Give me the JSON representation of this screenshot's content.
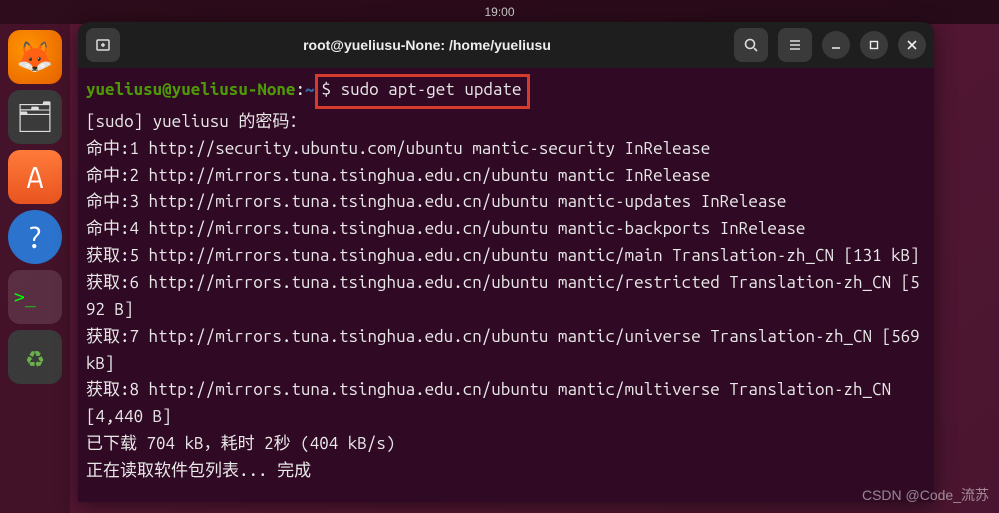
{
  "top_panel": {
    "clock": "19:00"
  },
  "dock": {
    "items": [
      {
        "name": "firefox",
        "glyph": "🦊"
      },
      {
        "name": "files",
        "glyph": "🗂"
      },
      {
        "name": "software",
        "glyph": "A"
      },
      {
        "name": "help",
        "glyph": "?"
      },
      {
        "name": "terminal",
        "glyph": ">_"
      },
      {
        "name": "trash",
        "glyph": "♻"
      }
    ]
  },
  "window": {
    "title": "root@yueliusu-None: /home/yueliusu"
  },
  "terminal": {
    "prompt": {
      "user_host": "yueliusu@yueliusu-None",
      "sep1": ":",
      "path": "~",
      "symbol": "$",
      "command": "sudo apt-get update"
    },
    "lines": [
      "[sudo] yueliusu 的密码：",
      "命中:1 http://security.ubuntu.com/ubuntu mantic-security InRelease",
      "命中:2 http://mirrors.tuna.tsinghua.edu.cn/ubuntu mantic InRelease",
      "命中:3 http://mirrors.tuna.tsinghua.edu.cn/ubuntu mantic-updates InRelease",
      "命中:4 http://mirrors.tuna.tsinghua.edu.cn/ubuntu mantic-backports InRelease",
      "获取:5 http://mirrors.tuna.tsinghua.edu.cn/ubuntu mantic/main Translation-zh_CN [131 kB]",
      "获取:6 http://mirrors.tuna.tsinghua.edu.cn/ubuntu mantic/restricted Translation-zh_CN [592 B]",
      "获取:7 http://mirrors.tuna.tsinghua.edu.cn/ubuntu mantic/universe Translation-zh_CN [569 kB]",
      "获取:8 http://mirrors.tuna.tsinghua.edu.cn/ubuntu mantic/multiverse Translation-zh_CN [4,440 B]",
      "已下载 704 kB，耗时 2秒 (404 kB/s)",
      "正在读取软件包列表... 完成"
    ]
  },
  "watermark": "CSDN @Code_流苏"
}
